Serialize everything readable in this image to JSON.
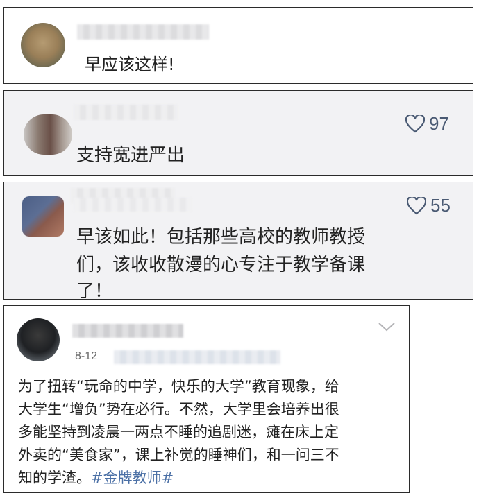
{
  "comments": [
    {
      "text": "早应该这样!"
    },
    {
      "text": "支持宽进严出",
      "likes": "97",
      "icon": "heart-outline-icon"
    },
    {
      "lines": [
        "早该如此！包括那些高校的教师教授",
        "们，该收收散漫的心专注于教学备课",
        "了！"
      ],
      "likes": "55",
      "icon": "heart-outline-icon"
    },
    {
      "date": "8-12",
      "lines": [
        "为了扭转“玩命的中学，快乐的大学”教育现象，给",
        "大学生“增负”势在必行。不然，大学里会培养出很",
        "多能坚持到凌晨一两点不睡的追剧迷，瘫在床上定",
        "外卖的“美食家”，课上补觉的睡神们，和一问三不"
      ],
      "last_line_prefix": "知的学渣。",
      "hashtag": "#金牌教师#",
      "icon": "chevron-down-icon"
    }
  ],
  "colors": {
    "like_gray": "#4a5a73",
    "hashtag_blue": "#4a6fa5",
    "panel_gray": "#f2f2f4"
  }
}
